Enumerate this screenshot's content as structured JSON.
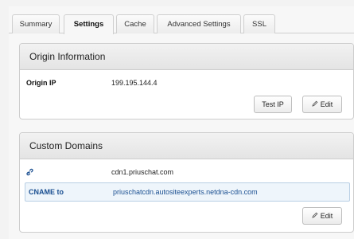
{
  "tabs": [
    {
      "label": "Summary",
      "active": false
    },
    {
      "label": "Settings",
      "active": true
    },
    {
      "label": "Cache",
      "active": false
    },
    {
      "label": "Advanced Settings",
      "active": false
    },
    {
      "label": "SSL",
      "active": false
    }
  ],
  "origin": {
    "title": "Origin Information",
    "ip_label": "Origin IP",
    "ip_value": "199.195.144.4",
    "test_button": "Test IP",
    "edit_button": "Edit"
  },
  "domains": {
    "title": "Custom Domains",
    "domain_icon": "link-icon",
    "domain_value": "cdn1.priuschat.com",
    "cname_label": "CNAME to",
    "cname_value": "priuschatcdn.autositeexperts.netdna-cdn.com",
    "edit_button": "Edit"
  },
  "colors": {
    "link_blue": "#1a4f91",
    "highlight_bg": "#eef5fb"
  }
}
